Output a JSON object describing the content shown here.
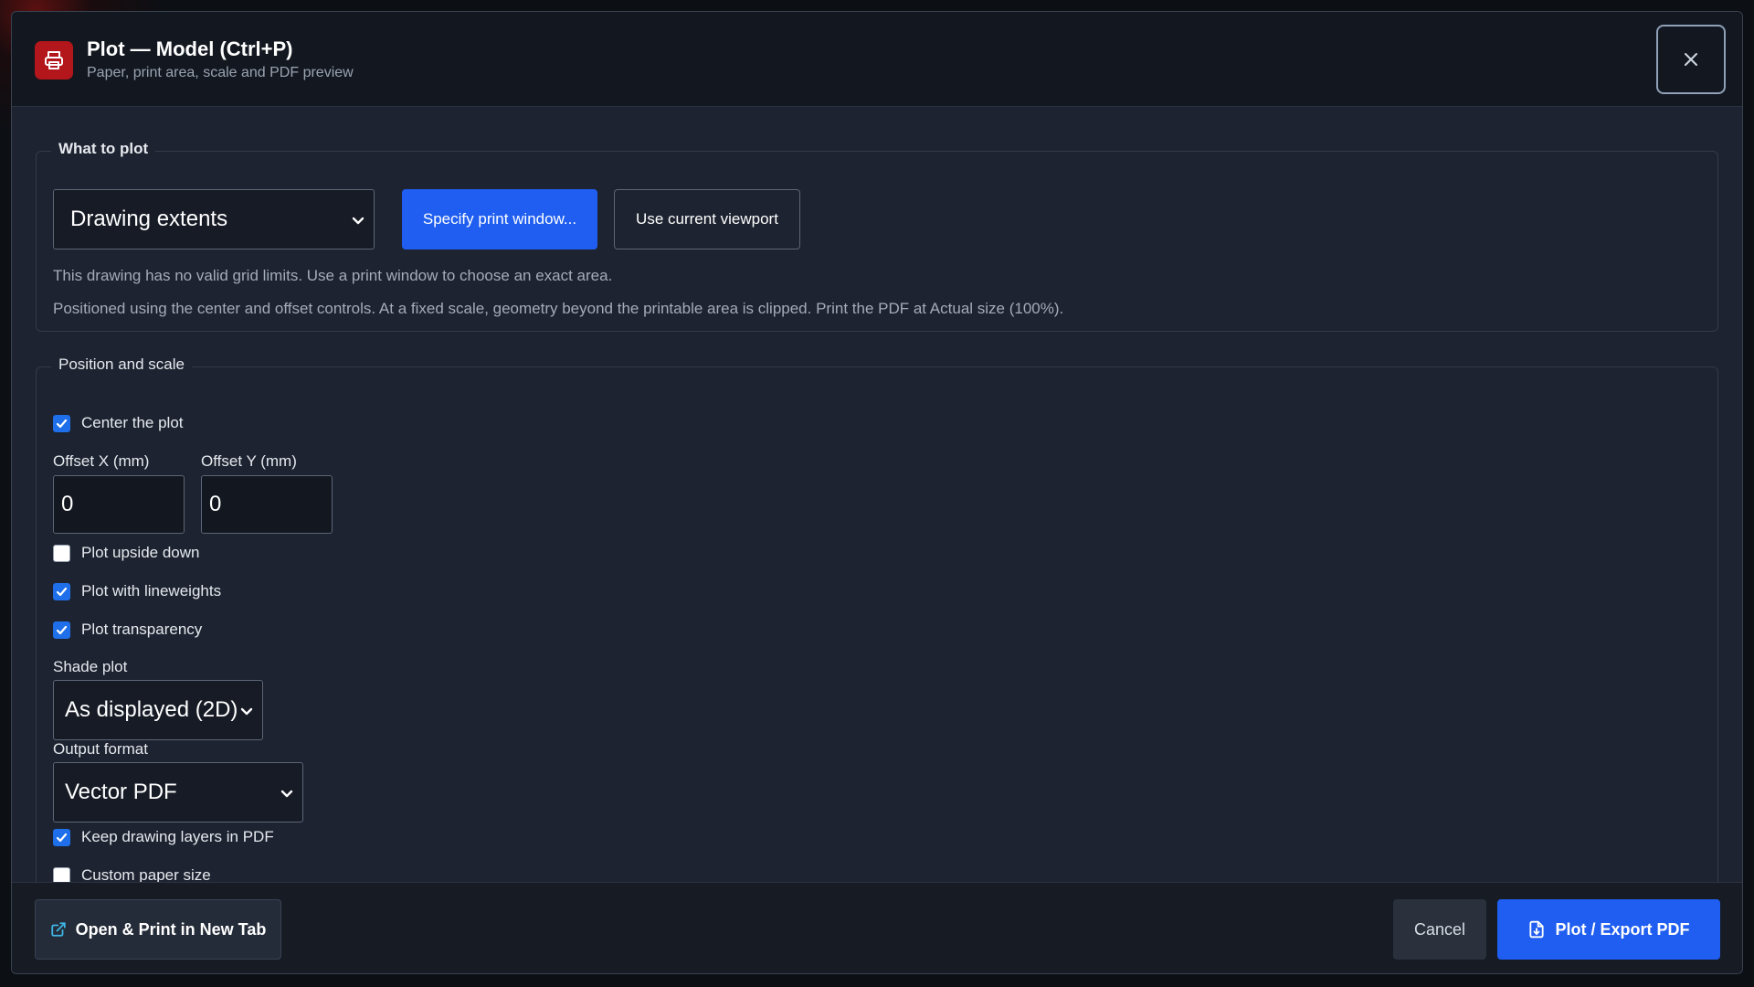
{
  "header": {
    "title": "Plot — Model (Ctrl+P)",
    "subtitle": "Paper, print area, scale and PDF preview",
    "app_icon": "printer-icon",
    "close_icon": "close-icon"
  },
  "what_to_plot": {
    "legend": "What to plot",
    "area_select": {
      "value": "Drawing extents"
    },
    "specify_window_label": "Specify print window...",
    "current_viewport_label": "Use current viewport",
    "hint_grid_limits": "This drawing has no valid grid limits. Use a print window to choose an exact area.",
    "hint_positioning": "Positioned using the center and offset controls. At a fixed scale, geometry beyond the printable area is clipped. Print the PDF at Actual size (100%)."
  },
  "position_scale": {
    "legend": "Position and scale",
    "center_plot": {
      "label": "Center the plot",
      "checked": true
    },
    "offset_x": {
      "label": "Offset X (mm)",
      "value": "0"
    },
    "offset_y": {
      "label": "Offset Y (mm)",
      "value": "0"
    },
    "upside_down": {
      "label": "Plot upside down",
      "checked": false
    },
    "lineweights": {
      "label": "Plot with lineweights",
      "checked": true
    },
    "transparency": {
      "label": "Plot transparency",
      "checked": true
    },
    "shade_plot": {
      "label": "Shade plot",
      "value": "As displayed (2D)"
    },
    "output_format": {
      "label": "Output format",
      "value": "Vector PDF"
    },
    "keep_layers": {
      "label": "Keep drawing layers in PDF",
      "checked": true
    },
    "custom_paper": {
      "label": "Custom paper size",
      "checked": false
    }
  },
  "footer": {
    "open_print_label": "Open & Print in New Tab",
    "open_print_icon": "external-link-icon",
    "cancel_label": "Cancel",
    "plot_export_label": "Plot / Export PDF",
    "plot_export_icon": "file-download-icon"
  },
  "colors": {
    "primary": "#1f5ef0",
    "dialog_bg": "#1d2330",
    "header_bg": "#131820",
    "app_icon_bg": "#b3161b",
    "link_icon": "#3fb6e6"
  }
}
